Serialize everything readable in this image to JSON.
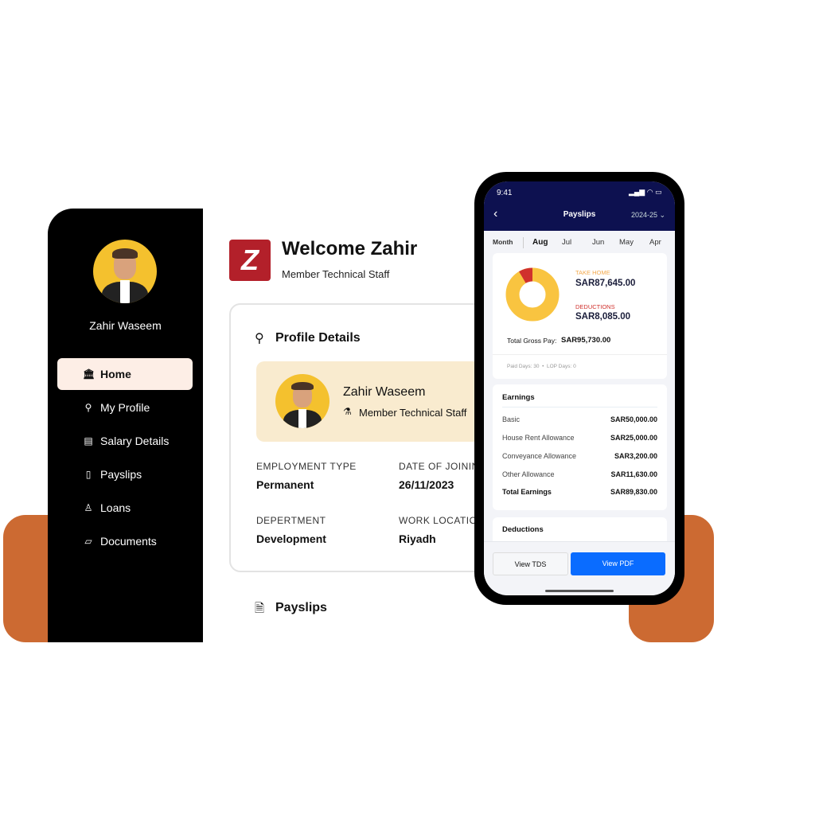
{
  "sidebar": {
    "user_name": "Zahir Waseem",
    "items": [
      {
        "label": "Home",
        "icon": "bank-icon"
      },
      {
        "label": "My Profile",
        "icon": "person-icon"
      },
      {
        "label": "Salary Details",
        "icon": "document-icon"
      },
      {
        "label": "Payslips",
        "icon": "payslip-icon"
      },
      {
        "label": "Loans",
        "icon": "loan-icon"
      },
      {
        "label": "Documents",
        "icon": "folder-icon"
      }
    ]
  },
  "header": {
    "welcome": "Welcome Zahir",
    "role": "Member Technical Staff",
    "logo_letter": "Z"
  },
  "profile": {
    "title": "Profile Details",
    "name": "Zahir Waseem",
    "role": "Member Technical Staff",
    "fields": [
      {
        "label": "EMPLOYMENT TYPE",
        "value": "Permanent"
      },
      {
        "label": "DATE OF JOINING",
        "value": "26/11/2023"
      },
      {
        "label": "DEPERTMENT",
        "value": "Development"
      },
      {
        "label": "WORK LOCATION",
        "value": "Riyadh"
      }
    ]
  },
  "payslips_heading": "Payslips",
  "phone": {
    "time": "9:41",
    "title": "Payslips",
    "year": "2024-25",
    "tabs": [
      "Month",
      "Aug",
      "Jul",
      "Jun",
      "May",
      "Apr"
    ],
    "take_home_label": "TAKE HOME",
    "take_home": "SAR87,645.00",
    "deductions_label": "DEDUCTIONS",
    "deductions": "SAR8,085.00",
    "gross_label": "Total Gross Pay:",
    "gross": "SAR95,730.00",
    "days": "Paid Days: 30  •  LOP Days: 0",
    "donut": {
      "take_home": 87645,
      "deductions": 8085,
      "take_home_color": "#f9c440",
      "deductions_color": "#d0312d"
    },
    "earnings_title": "Earnings",
    "earnings": [
      {
        "label": "Basic",
        "value": "SAR50,000.00"
      },
      {
        "label": "House Rent Allowance",
        "value": "SAR25,000.00"
      },
      {
        "label": "Conveyance Allowance",
        "value": "SAR3,200.00"
      },
      {
        "label": "Other Allowance",
        "value": "SAR11,630.00"
      }
    ],
    "total_label": "Total Earnings",
    "total": "SAR89,830.00",
    "deductions_title": "Deductions",
    "btn_tds": "View TDS",
    "btn_pdf": "View PDF"
  },
  "colors": {
    "accent": "#cc6a32",
    "brand": "#b3202a",
    "navy": "#0d1150",
    "primary": "#0a6cff"
  }
}
